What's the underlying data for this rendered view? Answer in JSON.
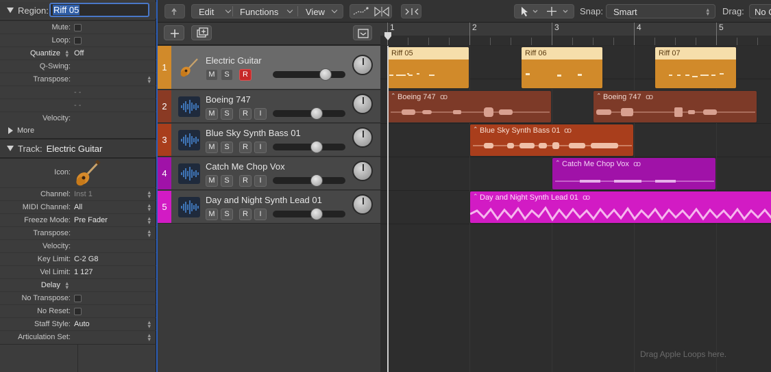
{
  "colors": {
    "guitar": "#d18a2a",
    "guitar_light": "#f6deab",
    "boeing": "#7d3a28",
    "bass": "#a93e1c",
    "vox": "#a012a8",
    "lead": "#d21bc4",
    "selection": "#2d5fb8"
  },
  "inspector": {
    "region_label": "Region:",
    "region_name": "Riff 05",
    "rows": [
      {
        "label": "Mute:",
        "type": "checkbox"
      },
      {
        "label": "Loop:",
        "type": "checkbox"
      },
      {
        "label": "Quantize",
        "value": "Off"
      },
      {
        "label": "Q-Swing:"
      },
      {
        "label": "Transpose:"
      },
      {
        "label": "",
        "value": "- -"
      },
      {
        "label": "",
        "value": "- -"
      },
      {
        "label": "Velocity:"
      }
    ],
    "more_label": "More",
    "track_label": "Track:",
    "track_name": "Electric Guitar",
    "icon_label": "Icon:",
    "track_rows": [
      {
        "label": "Channel:",
        "value": "Inst 1"
      },
      {
        "label": "MIDI Channel:",
        "value": "All"
      },
      {
        "label": "Freeze Mode:",
        "value": "Pre Fader"
      },
      {
        "label": "Transpose:",
        "value": ""
      },
      {
        "label": "Velocity:",
        "value": ""
      },
      {
        "label": "Key Limit:",
        "value": "C-2  G8"
      },
      {
        "label": "Vel Limit:",
        "value": "1  127"
      },
      {
        "label": "Delay",
        "value": ""
      },
      {
        "label": "No Transpose:",
        "type": "checkbox"
      },
      {
        "label": "No Reset:",
        "type": "checkbox"
      },
      {
        "label": "Staff Style:",
        "value": "Auto"
      },
      {
        "label": "Articulation Set:",
        "value": ""
      }
    ]
  },
  "toolbar": {
    "edit": "Edit",
    "functions": "Functions",
    "view": "View",
    "snap_label": "Snap:",
    "snap_value": "Smart",
    "drag_label": "Drag:",
    "drag_value": "No O"
  },
  "ruler": {
    "bars": [
      "1",
      "2",
      "3",
      "4",
      "5"
    ]
  },
  "tracks": [
    {
      "number": "1",
      "name": "Electric Guitar",
      "buttons": [
        "M",
        "S",
        "R"
      ],
      "fader": 0.73,
      "selected": true
    },
    {
      "number": "2",
      "name": "Boeing 747",
      "buttons": [
        "M",
        "S",
        "R",
        "I"
      ],
      "fader": 0.6
    },
    {
      "number": "3",
      "name": "Blue Sky Synth Bass 01",
      "buttons": [
        "M",
        "S",
        "R",
        "I"
      ],
      "fader": 0.6
    },
    {
      "number": "4",
      "name": "Catch Me Chop Vox",
      "buttons": [
        "M",
        "S",
        "R",
        "I"
      ],
      "fader": 0.6
    },
    {
      "number": "5",
      "name": "Day and Night Synth Lead 01",
      "buttons": [
        "M",
        "S",
        "R",
        "I"
      ],
      "fader": 0.6
    }
  ],
  "regions": {
    "riff05": "Riff 05",
    "riff06": "Riff 06",
    "riff07": "Riff 07",
    "boeing1": "Boeing 747",
    "boeing2": "Boeing 747",
    "bass": "Blue Sky Synth Bass 01",
    "vox": "Catch Me Chop Vox",
    "lead": "Day and Night Synth Lead 01"
  },
  "drag_hint": "Drag Apple Loops here."
}
